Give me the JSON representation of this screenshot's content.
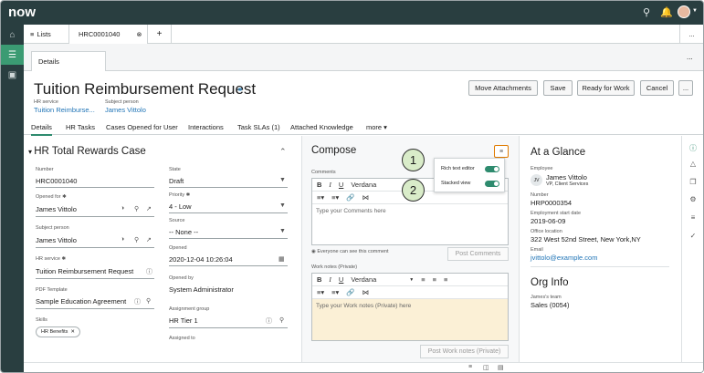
{
  "topbar": {
    "logo": "now",
    "icons": [
      "search-icon",
      "bell-icon",
      "help-icon"
    ]
  },
  "leftnav": {
    "items": [
      "home-icon",
      "list-icon",
      "inbox-icon"
    ]
  },
  "tabs": {
    "lists_label": "Lists",
    "record_tab": "HRC0001040",
    "add_label": "+",
    "more_label": "..."
  },
  "subtab": {
    "label": "Details",
    "more": "..."
  },
  "header": {
    "title": "Tuition Reimbursement Request",
    "hr_service_label": "HR service",
    "hr_service_value": "Tuition Reimburse...",
    "subject_person_label": "Subject person",
    "subject_person_value": "James Vittolo"
  },
  "actions": {
    "move_attachments": "Move Attachments",
    "save": "Save",
    "ready_for_work": "Ready for Work",
    "cancel": "Cancel",
    "more": "..."
  },
  "navtabs": [
    "Details",
    "HR Tasks",
    "Cases Opened for User",
    "Interactions",
    "Task SLAs (1)",
    "Attached Knowledge",
    "more ▾"
  ],
  "case": {
    "heading": "HR Total Rewards Case",
    "number_label": "Number",
    "number": "HRC0001040",
    "opened_for_label": "Opened for",
    "opened_for": "James Vittolo",
    "subject_label": "Subject person",
    "subject": "James Vittolo",
    "hr_service_label": "HR service",
    "hr_service": "Tuition Reimbursement Request",
    "pdf_label": "PDF Template",
    "pdf": "Sample Education Agreement",
    "skills_label": "Skills",
    "skill_chip": "HR Benefits",
    "state_label": "State",
    "state": "Draft",
    "priority_label": "Priority",
    "priority": "4 - Low",
    "source_label": "Source",
    "source": "-- None --",
    "opened_label": "Opened",
    "opened": "2020-12-04 10:26:04",
    "opened_by_label": "Opened by",
    "opened_by": "System Administrator",
    "assignment_group_label": "Assignment group",
    "assignment_group": "HR Tier 1",
    "assigned_to_label": "Assigned to"
  },
  "compose": {
    "heading": "Compose",
    "comments_label": "Comments",
    "font": "Verdana",
    "comments_placeholder": "Type your Comments here",
    "visibility_note": "Everyone can see this comment",
    "post_comments": "Post Comments",
    "work_notes_label": "Work notes (Private)",
    "work_notes_placeholder": "Type your Work notes (Private) here",
    "post_work_notes": "Post Work notes (Private)"
  },
  "popup": {
    "rich_text_label": "Rich text editor",
    "stacked_view_label": "Stacked view",
    "rich_text_on": true,
    "stacked_on": true
  },
  "callouts": {
    "one": "1",
    "two": "2"
  },
  "glance": {
    "heading": "At a Glance",
    "employee_label": "Employee",
    "employee_initials": "JV",
    "employee_name": "James Vittolo",
    "employee_title": "VP, Client Services",
    "number_label": "Number",
    "number": "HRP0000354",
    "start_label": "Employment start date",
    "start": "2019-06-09",
    "office_label": "Office location",
    "office": "322 West 52nd Street, New York,NY",
    "email_label": "Email",
    "email": "jvittolo@example.com",
    "org_heading": "Org Info",
    "team_label": "James's team",
    "team": "Sales (0054)"
  },
  "colors": {
    "topbar": "#293e40",
    "accent": "#2e8b6e",
    "link": "#2175b7",
    "callout_fill": "#d9ecc9",
    "highlight": "#e07b00",
    "work_notes_bg": "#fbf0d6"
  }
}
